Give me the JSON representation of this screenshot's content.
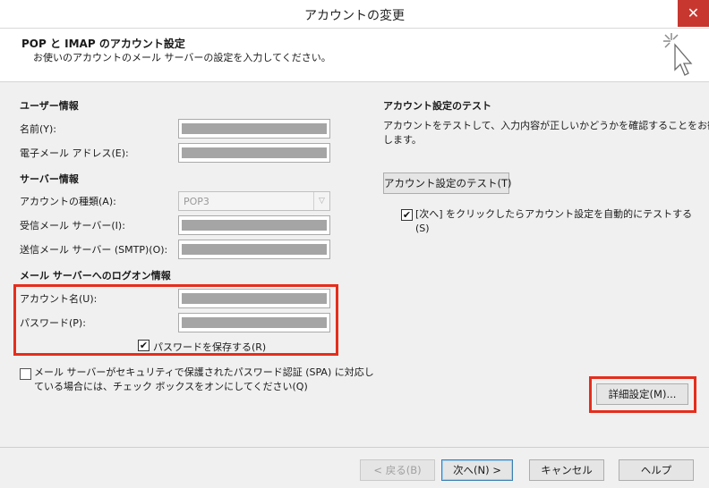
{
  "window": {
    "title": "アカウントの変更",
    "close_glyph": "✕"
  },
  "header": {
    "title": "POP と IMAP のアカウント設定",
    "subtitle": "お使いのアカウントのメール サーバーの設定を入力してください。"
  },
  "user_info": {
    "heading": "ユーザー情報",
    "name_label": "名前(Y):",
    "email_label": "電子メール アドレス(E):"
  },
  "server_info": {
    "heading": "サーバー情報",
    "account_type_label": "アカウントの種類(A):",
    "account_type_value": "POP3",
    "incoming_label": "受信メール サーバー(I):",
    "outgoing_label": "送信メール サーバー (SMTP)(O):"
  },
  "logon_info": {
    "heading": "メール サーバーへのログオン情報",
    "account_name_label": "アカウント名(U):",
    "password_label": "パスワード(P):",
    "remember_password_label": "パスワードを保存する(R)",
    "remember_password_checked": true,
    "spa_line1": "メール サーバーがセキュリティで保護されたパスワード認証 (SPA) に対応し",
    "spa_line2": "ている場合には、チェック ボックスをオンにしてください(Q)",
    "spa_checked": false
  },
  "test": {
    "heading": "アカウント設定のテスト",
    "description_line1": "アカウントをテストして、入力内容が正しいかどうかを確認することをお勧め",
    "description_line2": "します。",
    "test_button": "アカウント設定のテスト(T)",
    "auto_test_line1": "[次へ] をクリックしたらアカウント設定を自動的にテストする",
    "auto_test_line2": "(S)",
    "auto_test_checked": true,
    "more_settings_button": "詳細設定(M)..."
  },
  "footer": {
    "back_button": "< 戻る(B)",
    "next_button": "次へ(N) >",
    "cancel_button": "キャンセル",
    "help_button": "ヘルプ"
  },
  "colors": {
    "highlight": "#e52d1c",
    "close": "#c7372f",
    "masked_field": "#a5a5a5"
  },
  "icons": {
    "check": "✔",
    "dropdown": "▽"
  }
}
